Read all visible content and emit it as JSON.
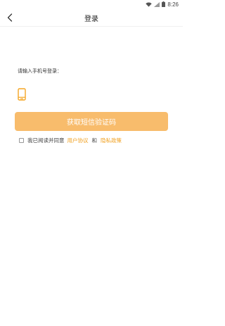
{
  "status_bar": {
    "time": "8:26",
    "icons": [
      "wifi-icon",
      "signal-icon",
      "battery-icon"
    ]
  },
  "nav": {
    "back_icon": "chevron-left-icon",
    "title": "登录"
  },
  "login": {
    "prompt": "请输入手机号登录：",
    "phone_icon": "mobile-phone-icon",
    "phone_value": "",
    "phone_placeholder": "",
    "code_button": "获取短信验证码"
  },
  "agreement": {
    "checked": false,
    "text": "我已阅读并同意",
    "user_agreement": "用户协议",
    "and": "和",
    "privacy_policy": "隐私政策"
  },
  "colors": {
    "accent": "#f8bc6c",
    "link": "#f0a020",
    "icon": "#f5a623"
  }
}
